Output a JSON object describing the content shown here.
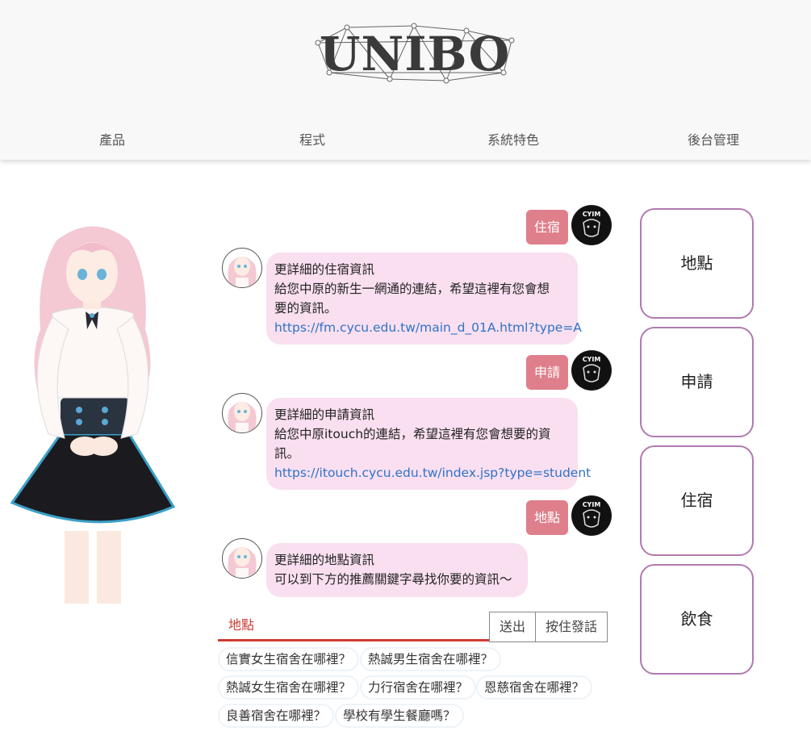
{
  "brand": {
    "logo_text": "UNIBO"
  },
  "nav": [
    "產品",
    "程式",
    "系統特色",
    "後台管理"
  ],
  "chat": [
    {
      "role": "user",
      "text": "住宿"
    },
    {
      "role": "bot",
      "lines": [
        "更詳細的住宿資訊",
        "給您中原的新生一網通的連結，希望這裡有您會想",
        "要的資訊。"
      ],
      "link": "https://fm.cycu.edu.tw/main_d_01A.html?type=A"
    },
    {
      "role": "user",
      "text": "申請"
    },
    {
      "role": "bot",
      "lines": [
        "更詳細的申請資訊",
        "給您中原itouch的連結，希望這裡有您會想要的資",
        "訊。"
      ],
      "link": "https://itouch.cycu.edu.tw/index.jsp?type=student"
    },
    {
      "role": "user",
      "text": "地點"
    },
    {
      "role": "bot",
      "lines": [
        "更詳細的地點資訊",
        "可以到下方的推薦關鍵字尋找你要的資訊～"
      ]
    }
  ],
  "user_avatar_text": "CYIM",
  "input": {
    "value": "地點",
    "send_label": "送出",
    "voice_label": "按住發話"
  },
  "suggestions": [
    "信實女生宿舍在哪裡？",
    "熱誠男生宿舍在哪裡？",
    "熱誠女生宿舍在哪裡？",
    "力行宿舍在哪裡？",
    "恩慈宿舍在哪裡？",
    "良善宿舍在哪裡？",
    "學校有學生餐廳嗎？"
  ],
  "side_buttons": [
    "地點",
    "申請",
    "住宿",
    "飲食"
  ],
  "colors": {
    "user_tag": "#df7f8b",
    "bot_bubble": "#f9dff0",
    "link": "#2f73c8",
    "input_underline": "#cf3b33",
    "side_border": "#b07ab0"
  }
}
